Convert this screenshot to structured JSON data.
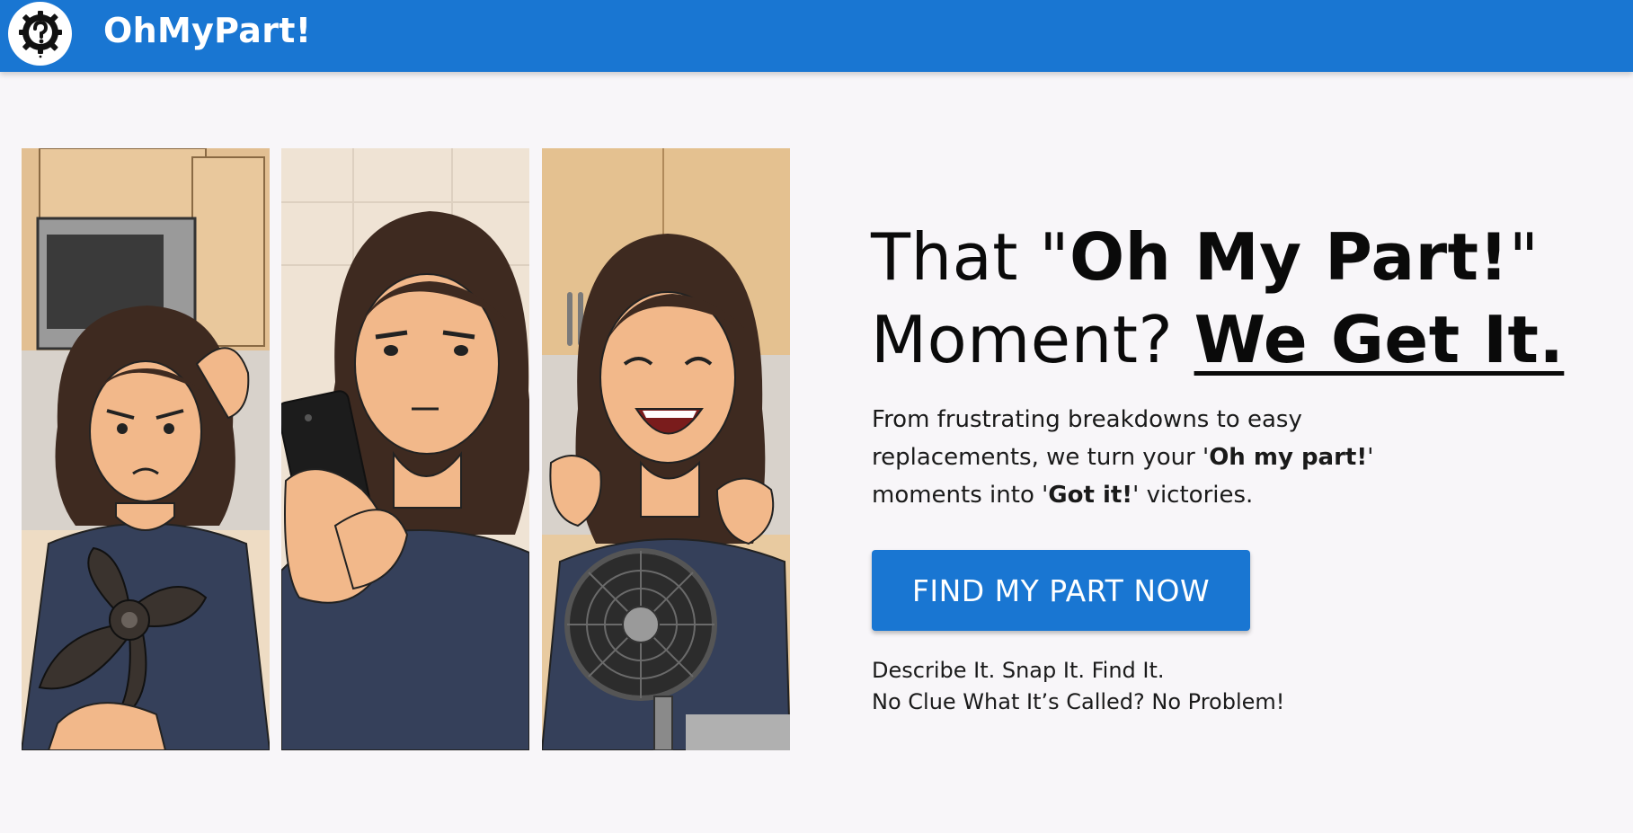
{
  "header": {
    "brand": "OhMyPart!",
    "logo_icon": "gear-question-icon",
    "bg_color": "#1976d2"
  },
  "hero": {
    "panels": [
      {
        "name": "frustrated-woman-with-broken-fan-blade"
      },
      {
        "name": "woman-using-smartphone"
      },
      {
        "name": "happy-woman-with-fixed-fan"
      }
    ],
    "headline": {
      "part1": "That \"",
      "part2": "Oh My Part!",
      "part3": "\"",
      "part4": "Moment? ",
      "part5": "We Get It."
    },
    "subtitle": {
      "line1": "From frustrating breakdowns to easy",
      "line2_a": "replacements, we turn your '",
      "line2_b": "Oh my part!",
      "line2_c": "'",
      "line3_a": "moments into '",
      "line3_b": "Got it!",
      "line3_c": "' victories."
    },
    "cta_label": "FIND MY PART NOW",
    "tagline1": "Describe It. Snap It. Find It.",
    "tagline2": "No Clue What It’s Called? No Problem!"
  }
}
